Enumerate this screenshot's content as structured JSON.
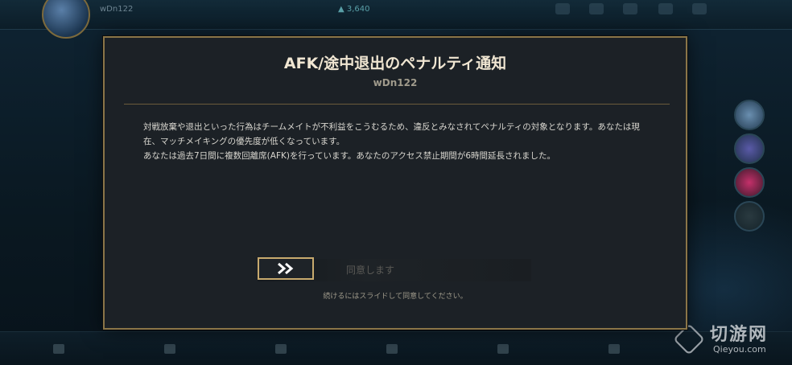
{
  "background": {
    "username": "wDn122",
    "currency": "▲ 3,640"
  },
  "modal": {
    "title": "AFK/途中退出のペナルティ通知",
    "subtitle": "wDn122",
    "body_line1": "対戦放棄や退出といった行為はチームメイトが不利益をこうむるため、違反とみなされてペナルティの対象となります。あなたは現在、マッチメイキングの優先度が低くなっています。",
    "body_line2": "あなたは過去7日間に複数回離席(AFK)を行っています。あなたのアクセス禁止期間が6時間延長されました。",
    "slider_label": "同意します",
    "slider_hint": "続けるにはスライドして同意してください。",
    "slider_icon": "double-chevron-right-icon"
  },
  "watermark": {
    "text": "切游网",
    "sub": "Qieyou.com"
  },
  "colors": {
    "accent_gold": "#c8aa6e",
    "modal_bg": "#1c2126",
    "title_text": "#f0e6d2"
  }
}
